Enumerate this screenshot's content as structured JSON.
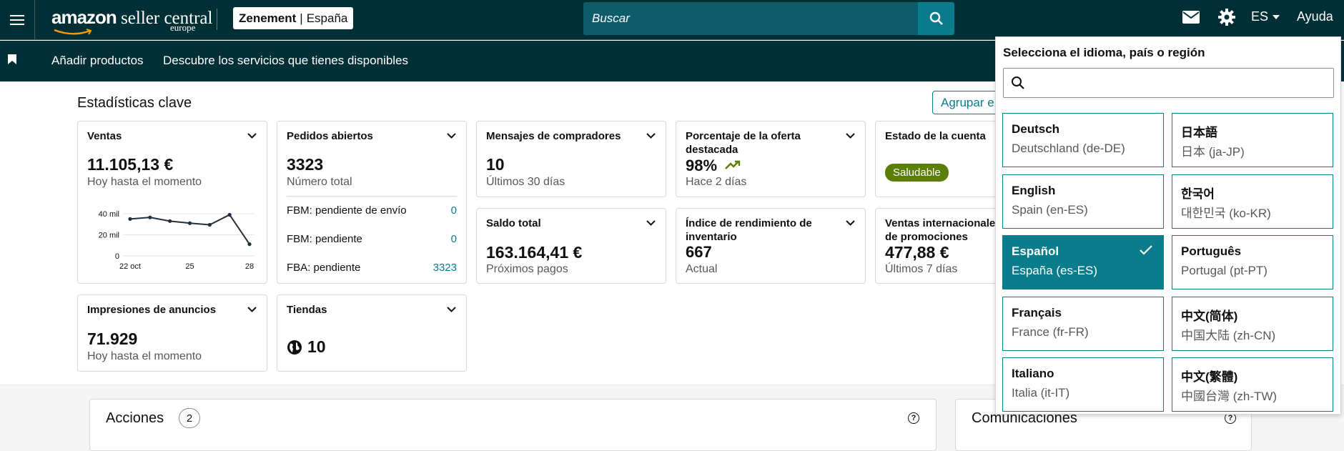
{
  "header": {
    "logo_main": "amazon",
    "logo_sc": " seller central",
    "logo_region": "europe",
    "store_name": "Zenement",
    "store_country": "España",
    "search_placeholder": "Buscar",
    "lang_code": "ES",
    "help": "Ayuda"
  },
  "subnav": {
    "links": [
      "Añadir productos",
      "Descubre los servicios que tienes disponibles"
    ]
  },
  "stats": {
    "title": "Estadísticas clave",
    "group_button": "Agrupar e",
    "ventas": {
      "title": "Ventas",
      "value": "11.105,13 €",
      "sub": "Hoy hasta el momento"
    },
    "pedidos": {
      "title": "Pedidos abiertos",
      "value": "3323",
      "sub": "Número total",
      "rows": [
        {
          "label": "FBM: pendiente de envío",
          "value": "0"
        },
        {
          "label": "FBM: pendiente",
          "value": "0"
        },
        {
          "label": "FBA: pendiente",
          "value": "3323"
        }
      ]
    },
    "mensajes": {
      "title": "Mensajes de compradores",
      "value": "10",
      "sub": "Últimos 30 días"
    },
    "oferta": {
      "title": "Porcentaje de la oferta destacada",
      "value": "98%",
      "sub": "Hace 2 días"
    },
    "estado": {
      "title": "Estado de la cuenta",
      "badge": "Saludable"
    },
    "saldo": {
      "title": "Saldo total",
      "value": "163.164,41 €",
      "sub": "Próximos pagos"
    },
    "indice": {
      "title": "Índice de rendimiento de inventario",
      "value": "667",
      "sub": "Actual"
    },
    "internacional": {
      "title": "Ventas internacionales derivadas de promociones",
      "value": "477,88 €",
      "sub": "Últimos 7 días"
    },
    "impresiones": {
      "title": "Impresiones de anuncios",
      "value": "71.929",
      "sub": "Hoy hasta el momento"
    },
    "tiendas": {
      "title": "Tiendas",
      "value": "10"
    }
  },
  "chart_data": {
    "type": "line",
    "x": [
      22,
      23,
      24,
      25,
      26,
      27,
      28
    ],
    "values": [
      35000,
      36500,
      33000,
      31000,
      29500,
      39000,
      11105
    ],
    "xticks": [
      "22 oct",
      "25",
      "28"
    ],
    "yticks": [
      "40 mil",
      "20 mil",
      "0"
    ],
    "ylim": [
      0,
      40000
    ],
    "color": "#232f3e"
  },
  "bottom": {
    "acciones": "Acciones",
    "acciones_count": "2",
    "comunicaciones": "Comunicaciones"
  },
  "lang_panel": {
    "title": "Selecciona el idioma, país o región",
    "options": [
      {
        "name": "Deutsch",
        "detail": "Deutschland (de-DE)",
        "selected": false
      },
      {
        "name": "日本語",
        "detail": "日本 (ja-JP)",
        "selected": false
      },
      {
        "name": "English",
        "detail": "Spain (en-ES)",
        "selected": false
      },
      {
        "name": "한국어",
        "detail": "대한민국 (ko-KR)",
        "selected": false
      },
      {
        "name": "Español",
        "detail": "España (es-ES)",
        "selected": true
      },
      {
        "name": "Português",
        "detail": "Portugal (pt-PT)",
        "selected": false
      },
      {
        "name": "Français",
        "detail": "France (fr-FR)",
        "selected": false
      },
      {
        "name": "中文(简体)",
        "detail": "中国大陆 (zh-CN)",
        "selected": false
      },
      {
        "name": "Italiano",
        "detail": "Italia (it-IT)",
        "selected": false
      },
      {
        "name": "中文(繁體)",
        "detail": "中國台灣 (zh-TW)",
        "selected": false
      }
    ]
  },
  "colors": {
    "header_bg": "#002f36",
    "accent": "#0a7c8c",
    "healthy": "#5b7e06"
  }
}
